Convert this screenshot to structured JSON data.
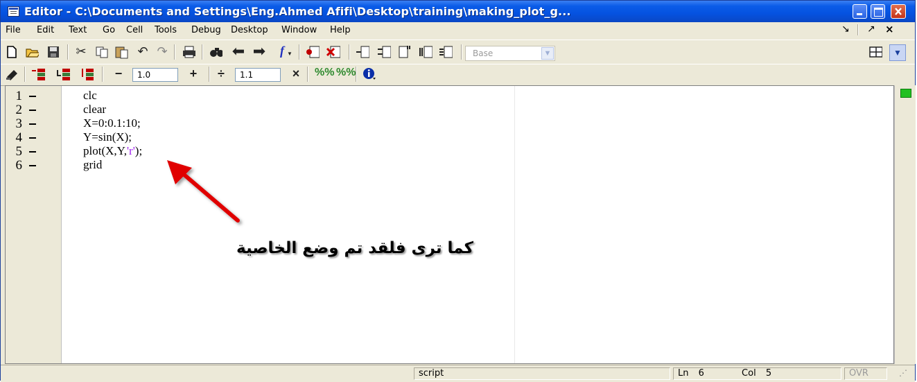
{
  "window": {
    "title": "Editor - C:\\Documents and Settings\\Eng.Ahmed Afifi\\Desktop\\training\\making_plot_g...",
    "minimize_icon": "minimize-icon",
    "maximize_icon": "maximize-icon",
    "close_icon": "close-icon"
  },
  "menu": {
    "items": [
      "File",
      "Edit",
      "Text",
      "Go",
      "Cell",
      "Tools",
      "Debug",
      "Desktop",
      "Window",
      "Help"
    ],
    "dock_icons": [
      "dock-icon",
      "undock-icon",
      "close-doc-icon"
    ]
  },
  "toolbar": {
    "stack_combo": "Base",
    "layout_icon": "tile-layout-icon"
  },
  "cell_toolbar": {
    "decrement_label": "−",
    "increment_label": "+",
    "increment_value": "1.0",
    "divide_label": "÷",
    "multiply_label": "×",
    "scale_value": "1.1"
  },
  "editor": {
    "lines": [
      {
        "number": "1",
        "code": "clc"
      },
      {
        "number": "2",
        "code": "clear"
      },
      {
        "number": "3",
        "code": "X=0:0.1:10;"
      },
      {
        "number": "4",
        "code": "Y=sin(X);"
      },
      {
        "number": "5",
        "code_before": "plot(X,Y,",
        "code_string": "'r'",
        "code_after": ");"
      },
      {
        "number": "6",
        "code": "grid"
      }
    ]
  },
  "annotation": {
    "text": "كما ترى فلقد تم وضع الخاصية",
    "arrow_color": "#e00000"
  },
  "status": {
    "mode": "script",
    "ln_label": "Ln",
    "ln_value": "6",
    "col_label": "Col",
    "col_value": "5",
    "ovr": "OVR"
  },
  "colors": {
    "titlebar": "#0552e0",
    "string_literal": "#a020f0",
    "indicator": "#22c022"
  }
}
